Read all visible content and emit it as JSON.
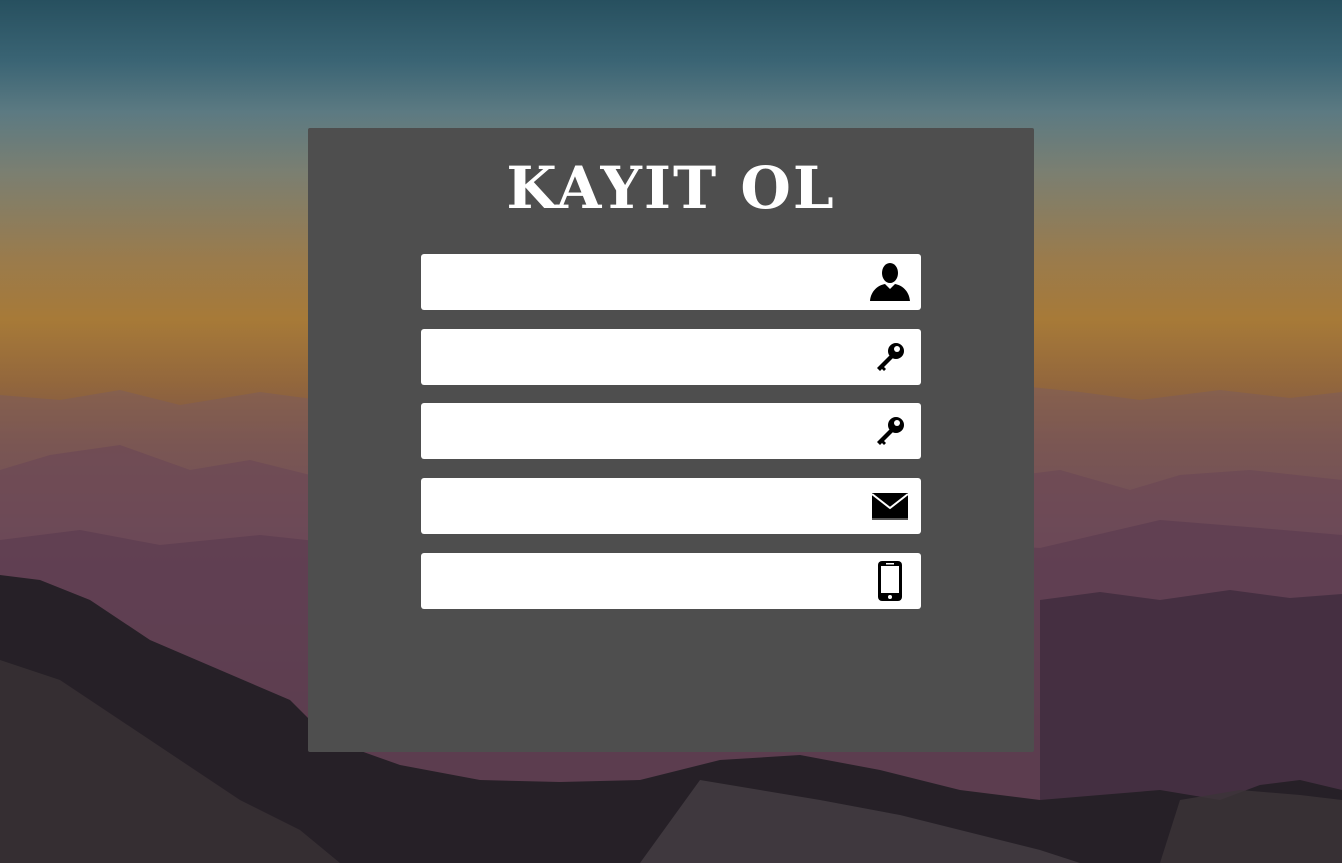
{
  "title": "KAYIT OL",
  "fields": [
    {
      "icon": "user-icon",
      "placeholder": ""
    },
    {
      "icon": "key-icon",
      "placeholder": ""
    },
    {
      "icon": "key-icon",
      "placeholder": ""
    },
    {
      "icon": "mail-icon",
      "placeholder": ""
    },
    {
      "icon": "phone-icon",
      "placeholder": ""
    }
  ],
  "colors": {
    "panel": "#4e4e4e",
    "field": "#ffffff",
    "icon": "#000000",
    "title": "#ffffff"
  }
}
